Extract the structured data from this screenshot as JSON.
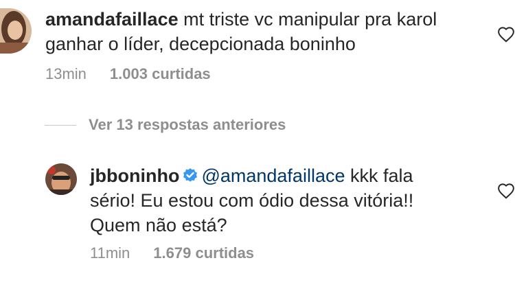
{
  "comments": [
    {
      "username": "amandafaillace",
      "text": " mt triste vc manipular pra karol ganhar o líder, decepcionada boninho",
      "time": "13min",
      "likes": "1.003 curtidas",
      "avatar_icon": "user-photo-avatar",
      "like_icon": "heart-outline-icon"
    }
  ],
  "replies_toggle": {
    "label": "Ver 13 respostas anteriores"
  },
  "reply": {
    "username": "jbboninho",
    "verified_icon": "verified-badge-icon",
    "mention": "@amandafaillace",
    "text": " kkk fala sério! Eu estou com ódio dessa vitória!! Quem não está?",
    "time": "11min",
    "likes": "1.679 curtidas",
    "avatar_icon": "user-photo-avatar",
    "like_icon": "heart-outline-icon"
  },
  "colors": {
    "text": "#262626",
    "secondary": "#8e8e8e",
    "mention": "#00376b",
    "verified": "#3897f0"
  }
}
